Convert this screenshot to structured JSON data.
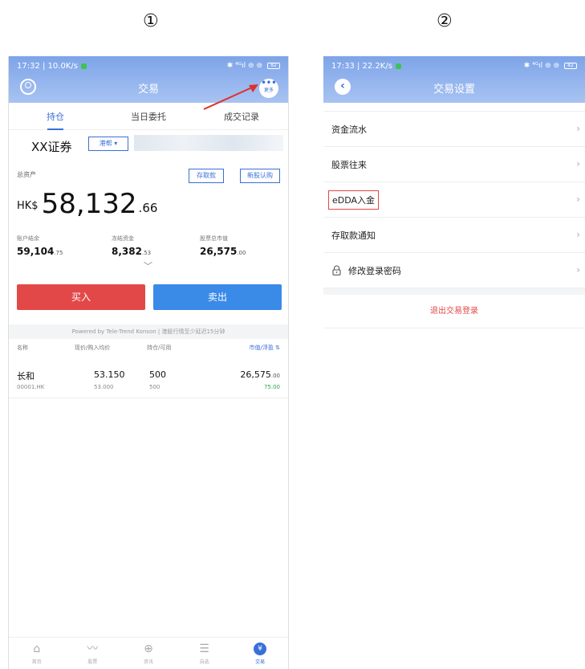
{
  "steps": {
    "one": "①",
    "two": "②"
  },
  "screen1": {
    "status": {
      "time_speed": "17:32 | 10.0K/s",
      "right_icons": "✱ ⁴ᴳıl ⊜ ⊜",
      "battery": "82"
    },
    "title": "交易",
    "more_label": "更多",
    "tabs": [
      "持仓",
      "当日委托",
      "成交记录"
    ],
    "broker": {
      "name": "XX证券",
      "market": "港帮 ▾"
    },
    "assets": {
      "label": "总资产",
      "deposit_button": "存取款",
      "ipo_button": "新股认购",
      "currency": "HK$",
      "integer": "58,132",
      "cents": ".66"
    },
    "stats": [
      {
        "label": "账户结余",
        "value": "59,104",
        "decimals": ".75"
      },
      {
        "label": "冻结资金",
        "value": "8,382",
        "decimals": ".53"
      },
      {
        "label": "股票总市值",
        "value": "26,575",
        "decimals": ".00"
      }
    ],
    "buy_button": "买入",
    "sell_button": "卖出",
    "powered_by": "Powered by Tele-Trend Konson | 港股行情至少延迟15分钟",
    "table_head": {
      "name": "名称",
      "price": "现价/购入均价",
      "qty": "持仓/可用",
      "mv": "市值/浮盈 ⇅"
    },
    "holdings": [
      {
        "name": "长和",
        "code": "00001.HK",
        "price": "53.150",
        "cost": "53.000",
        "qty": "500",
        "avail": "500",
        "mv": "26,575",
        "mv_dec": ".00",
        "pl": "75.00"
      }
    ],
    "nav": [
      {
        "label": "首页",
        "glyph": "⌂"
      },
      {
        "label": "股票",
        "glyph": "〰"
      },
      {
        "label": "资讯",
        "glyph": "⊕"
      },
      {
        "label": "自选",
        "glyph": "☰"
      },
      {
        "label": "交易",
        "glyph": "¥"
      }
    ]
  },
  "screen2": {
    "status": {
      "time_speed": "17:33 | 22.2K/s",
      "right_icons": "✱ ⁴ᴳıl ⊜ ⊜",
      "battery": "82"
    },
    "title": "交易设置",
    "menu": [
      "资金流水",
      "股票往来",
      "eDDA入金",
      "存取款通知",
      "修改登录密码"
    ],
    "logout": "退出交易登录"
  },
  "colors": {
    "accent": "#3a6fd9",
    "buy": "#e34848",
    "sell": "#3a8ae8",
    "header": "#7da4e8"
  }
}
